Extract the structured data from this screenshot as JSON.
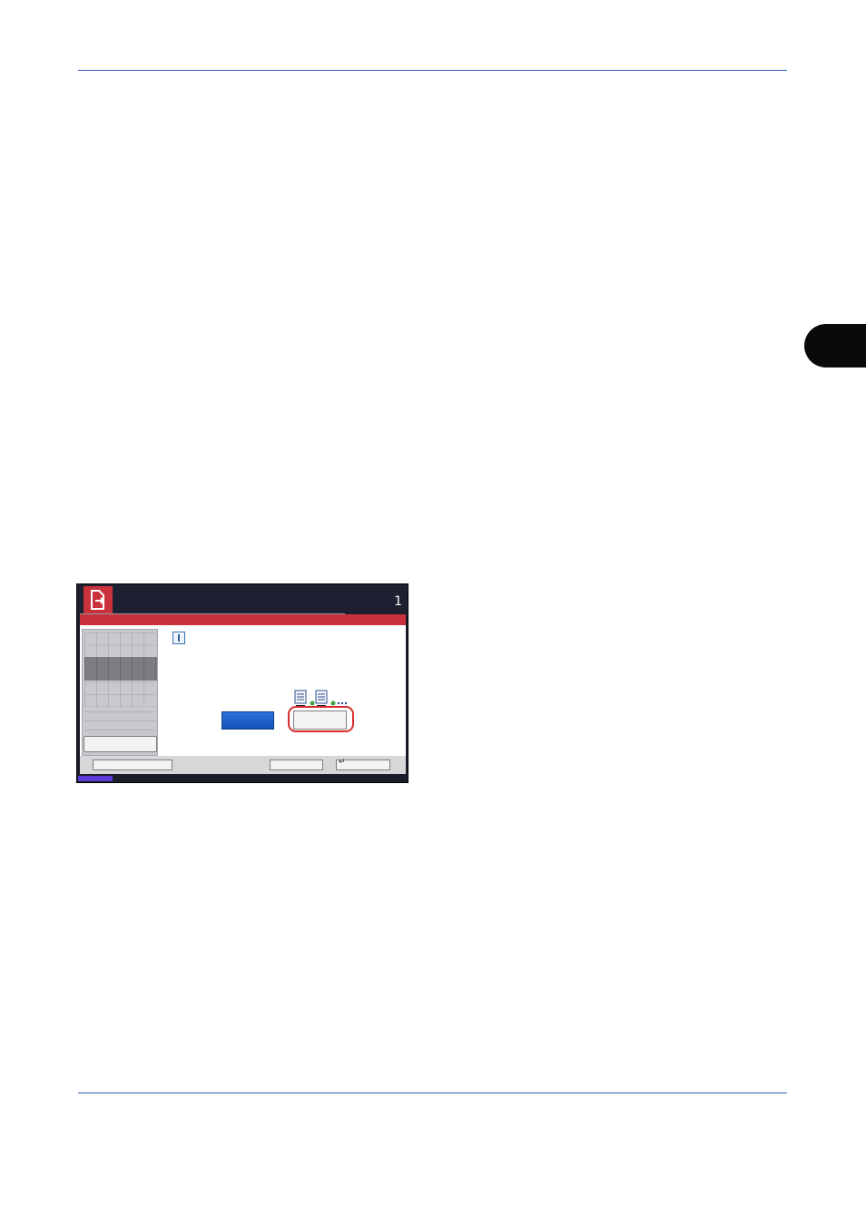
{
  "panel": {
    "job_count": "1",
    "icons": {
      "mode": "document-send-icon",
      "info": "info-icon",
      "continuous_scan": "continuous-scan-icon",
      "enter": "enter-icon"
    },
    "footer": {
      "enter_glyph": "↵"
    }
  },
  "colors": {
    "rule": "#2d5bb5",
    "chapter_tab": "#0a0a0a",
    "accent_red": "#c9313b",
    "ok_blue": "#1a5fcc",
    "highlight_ring": "#d92d2d",
    "status_purple": "#5b3bd6"
  }
}
